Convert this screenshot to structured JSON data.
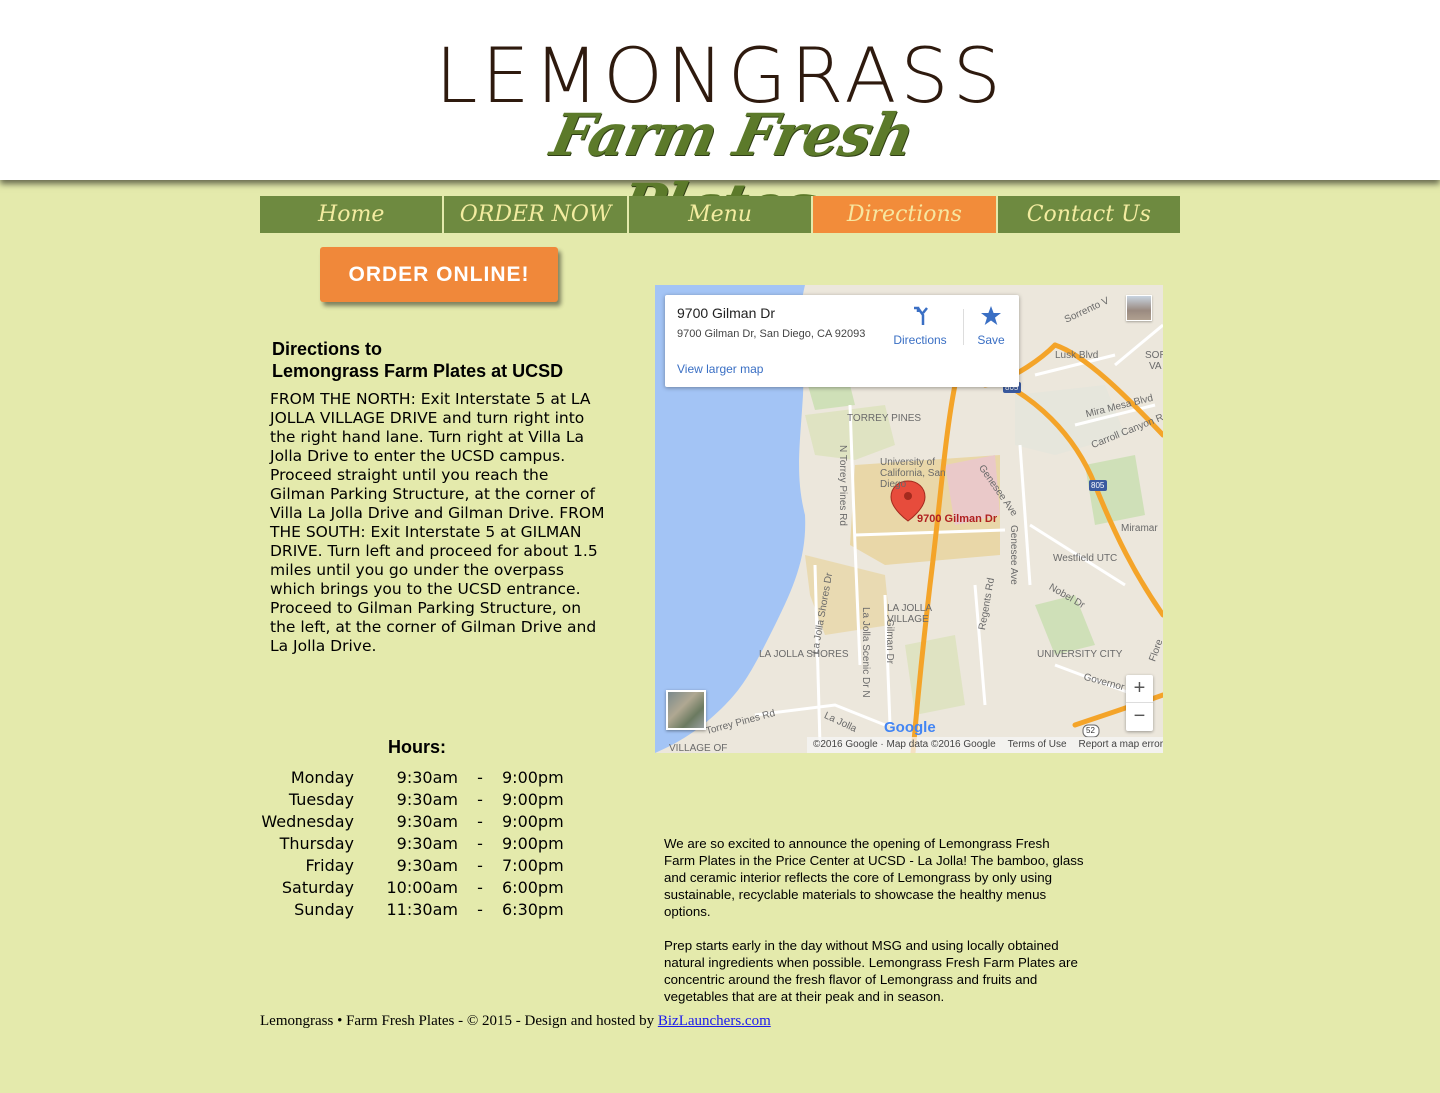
{
  "logo": {
    "main": "LEMONGRASS",
    "sub": "Farm Fresh Plates"
  },
  "nav": {
    "items": [
      {
        "label": "Home"
      },
      {
        "label": "ORDER NOW"
      },
      {
        "label": "Menu"
      },
      {
        "label": "Directions",
        "active": true
      },
      {
        "label": "Contact Us"
      }
    ]
  },
  "order_button": "ORDER ONLINE!",
  "directions": {
    "title_line1": "Directions to",
    "title_line2": "Lemongrass Farm Plates at UCSD",
    "text": "FROM THE NORTH: Exit Interstate 5 at LA JOLLA VILLAGE DRIVE and turn right into the right hand lane. Turn right at Villa La Jolla Drive to enter the UCSD campus. Proceed straight until you reach the Gilman Parking Structure, at the corner of Villa La Jolla Drive and Gilman Drive.    FROM THE SOUTH: Exit Interstate 5 at GILMAN DRIVE. Turn left and proceed for about 1.5 miles until you go under the overpass which brings you to the UCSD entrance. Proceed to Gilman Parking Structure, on the left, at the corner of Gilman Drive and La Jolla Drive."
  },
  "hours": {
    "title": "Hours:",
    "rows": [
      {
        "day": "Monday",
        "open": "9:30am",
        "dash": "-",
        "close": "9:00pm"
      },
      {
        "day": "Tuesday",
        "open": "9:30am",
        "dash": "-",
        "close": "9:00pm"
      },
      {
        "day": "Wednesday",
        "open": "9:30am",
        "dash": "-",
        "close": "9:00pm"
      },
      {
        "day": "Thursday",
        "open": "9:30am",
        "dash": "-",
        "close": "9:00pm"
      },
      {
        "day": "Friday",
        "open": "9:30am",
        "dash": "-",
        "close": "7:00pm"
      },
      {
        "day": "Saturday",
        "open": "10:00am",
        "dash": "-",
        "close": "6:00pm"
      },
      {
        "day": "Sunday",
        "open": "11:30am",
        "dash": "-",
        "close": "6:30pm"
      }
    ]
  },
  "map": {
    "card_title": "9700 Gilman Dr",
    "card_address": "9700 Gilman Dr, San Diego, CA 92093",
    "directions_label": "Directions",
    "save_label": "Save",
    "larger_map_label": "View larger map",
    "marker_label": "9700 Gilman Dr",
    "zoom_in": "+",
    "zoom_out": "−",
    "google_mark": "Google",
    "attribution": "©2016 Google · Map data ©2016 Google",
    "terms": "Terms of Use",
    "report": "Report a map error",
    "labels": {
      "torrey_pines": "TORREY PINES",
      "university": "University of California, San Diego",
      "genesee_ave_1": "Genesee Ave",
      "genesee_ave_2": "Genesee Ave",
      "westfield": "Westfield UTC",
      "la_jolla_village": "LA JOLLA VILLAGE",
      "la_jolla_shores": "LA JOLLA SHORES",
      "university_city": "UNIVERSITY CITY",
      "n_torrey_pines": "N Torrey Pines Rd",
      "la_jolla_shores_dr": "La Jolla Shores Dr",
      "la_jolla_scenic": "La Jolla Scenic Dr N",
      "gilman_dr": "Gilman Dr",
      "regents_rd": "Regents Rd",
      "nobel_dr": "Nobel Dr",
      "torrey_pines_rd": "Torrey Pines Rd",
      "la_jolla_road": "La Jolla",
      "village_of": "VILLAGE OF",
      "lusk_blvd": "Lusk Blvd",
      "mira_mesa": "Mira Mesa Blvd",
      "carroll_canyon": "Carroll Canyon Rd",
      "sorrento": "Sorrento V",
      "miramar": "Miramar",
      "governor": "Governor",
      "florida": "Flore",
      "sor": "SOR",
      "va": "VA",
      "i805_top": "805",
      "i805_mid": "805",
      "r52": "52"
    }
  },
  "about": {
    "p1": "We are so excited to announce the opening of Lemongrass Fresh Farm Plates in the Price Center at UCSD - La Jolla! The bamboo, glass and ceramic interior reflects the core of Lemongrass by only using sustainable, recyclable materials to showcase the healthy menus options.",
    "p2": "Prep starts early in the day without MSG and using locally obtained natural ingredients when possible. Lemongrass Fresh Farm Plates are concentric around the fresh flavor of Lemongrass and fruits and vegetables that are at their peak and in season."
  },
  "footer": {
    "text": "Lemongrass  • Farm Fresh Plates - © 2015 - Design and hosted by ",
    "link": "BizLaunchers.com"
  },
  "colors": {
    "background": "#e4eaac",
    "nav": "#6e8a40",
    "nav_active": "#f28c3a",
    "order_button": "#f0883a",
    "logo_dark": "#2e1a0e",
    "logo_green": "#5c7a2a"
  }
}
